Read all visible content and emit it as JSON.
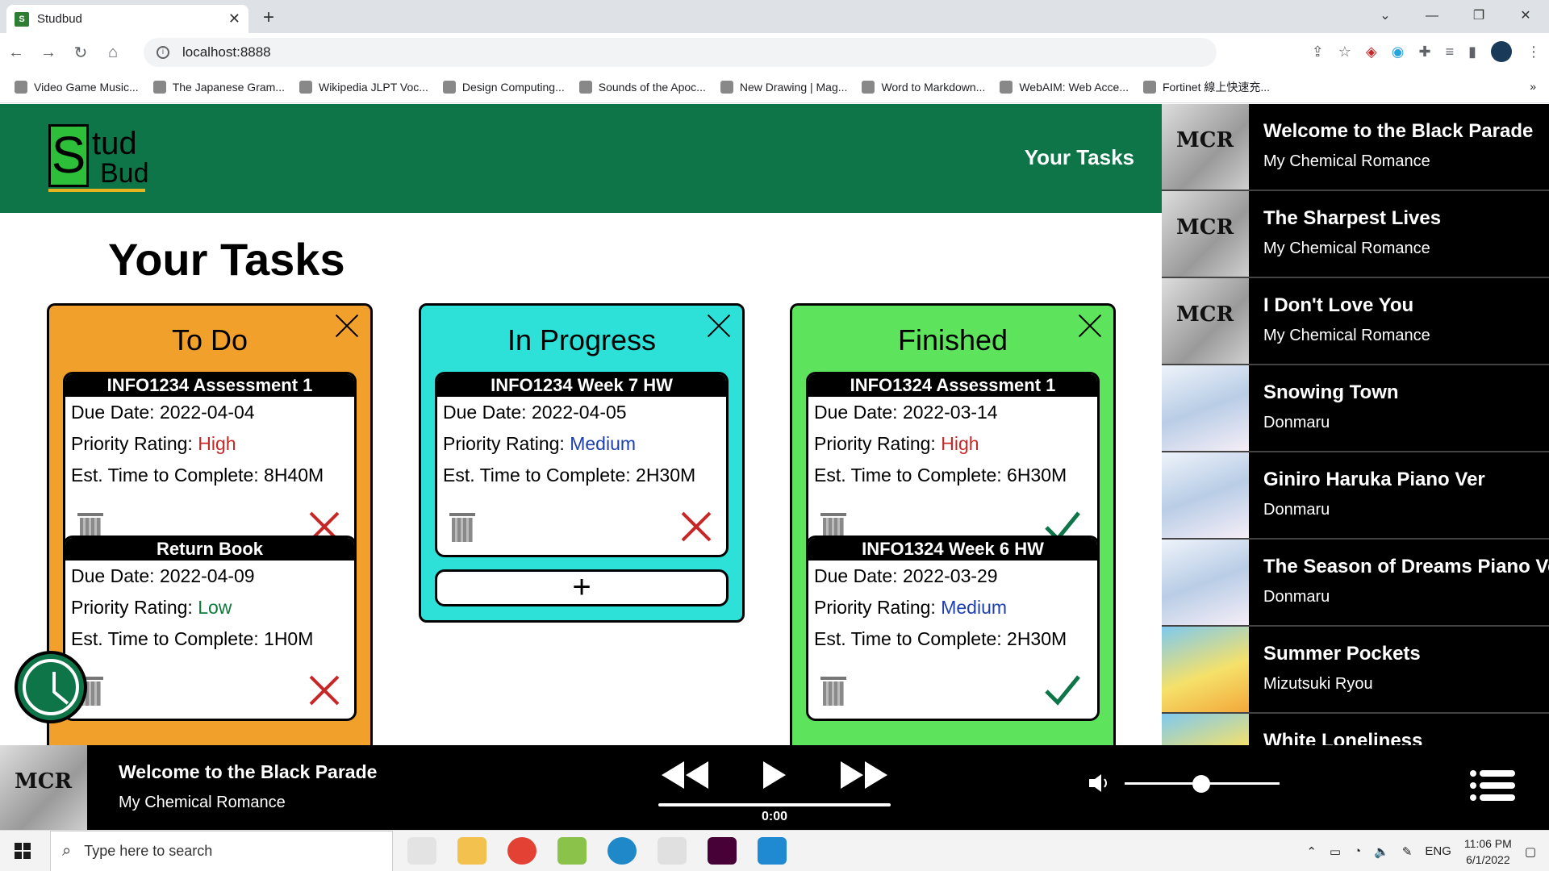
{
  "browser": {
    "tab_title": "Studbud",
    "tab_favicon": "S",
    "url": "localhost:8888",
    "bookmarks": [
      "Video Game Music...",
      "The Japanese Gram...",
      "Wikipedia JLPT Voc...",
      "Design Computing...",
      "Sounds of the Apoc...",
      "New Drawing | Mag...",
      "Word to Markdown...",
      "WebAIM: Web Acce...",
      "Fortinet 線上快速充..."
    ]
  },
  "header": {
    "logo_s": "S",
    "logo_stud": "tud",
    "logo_bud": "Bud",
    "nav_tasks": "Your Tasks",
    "color": "#0e7548"
  },
  "page_title": "Your Tasks",
  "columns": [
    {
      "title": "To Do",
      "color": "#f0a02b",
      "cards": [
        {
          "name": "INFO1234 Assessment 1",
          "due_label": "Due Date: ",
          "due": "2022-04-04",
          "prio_label": "Priority Rating: ",
          "priority": "High",
          "est_label": "Est. Time to Complete: ",
          "est": "8H40M",
          "action": "x-icon"
        },
        {
          "name": "Return Book",
          "due_label": "Due Date: ",
          "due": "2022-04-09",
          "prio_label": "Priority Rating: ",
          "priority": "Low",
          "est_label": "Est. Time to Complete: ",
          "est": "1H0M",
          "action": "x-icon"
        }
      ]
    },
    {
      "title": "In Progress",
      "color": "#2de0d8",
      "cards": [
        {
          "name": "INFO1234 Week 7 HW",
          "due_label": "Due Date: ",
          "due": "2022-04-05",
          "prio_label": "Priority Rating: ",
          "priority": "Medium",
          "est_label": "Est. Time to Complete: ",
          "est": "2H30M",
          "action": "x-icon"
        }
      ],
      "add_label": "+"
    },
    {
      "title": "Finished",
      "color": "#5ee35c",
      "cards": [
        {
          "name": "INFO1324 Assessment 1",
          "due_label": "Due Date: ",
          "due": "2022-03-14",
          "prio_label": "Priority Rating: ",
          "priority": "High",
          "est_label": "Est. Time to Complete: ",
          "est": "6H30M",
          "action": "check-icon"
        },
        {
          "name": "INFO1324 Week 6 HW",
          "due_label": "Due Date: ",
          "due": "2022-03-29",
          "prio_label": "Priority Rating: ",
          "priority": "Medium",
          "est_label": "Est. Time to Complete: ",
          "est": "2H30M",
          "action": "check-icon"
        }
      ]
    }
  ],
  "playlist": [
    {
      "title": "Welcome to the Black Parade",
      "artist": "My Chemical Romance",
      "art": "mcr"
    },
    {
      "title": "The Sharpest Lives",
      "artist": "My Chemical Romance",
      "art": "mcr"
    },
    {
      "title": "I Don't Love You",
      "artist": "My Chemical Romance",
      "art": "mcr"
    },
    {
      "title": "Snowing Town",
      "artist": "Donmaru",
      "art": "don"
    },
    {
      "title": "Giniro Haruka Piano Ver",
      "artist": "Donmaru",
      "art": "don"
    },
    {
      "title": "The Season of Dreams Piano Ver",
      "artist": "Donmaru",
      "art": "don"
    },
    {
      "title": "Summer Pockets",
      "artist": "Mizutsuki Ryou",
      "art": "sp"
    },
    {
      "title": "White Loneliness",
      "artist": "",
      "art": "sp"
    }
  ],
  "player": {
    "title": "Welcome to the Black Parade",
    "artist": "My Chemical Romance",
    "time": "0:00",
    "progress": 0,
    "volume": 0.44
  },
  "taskbar": {
    "search_placeholder": "Type here to search",
    "lang": "ENG",
    "time": "11:06 PM",
    "date": "6/1/2022"
  }
}
